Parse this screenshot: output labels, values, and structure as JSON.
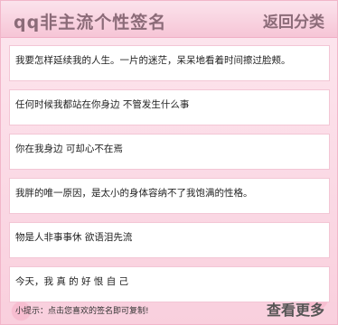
{
  "header": {
    "title": "qq非主流个性签名",
    "back_label": "返回分类"
  },
  "signatures": [
    "我要怎样延续我的人生。一片的迷茫，呆呆地看着时间擦过脸颊。",
    "任何时候我都站在你身边 不管发生什么事",
    "你在我身边 可却心不在焉",
    "我胖的唯一原因，是太小的身体容纳不了我饱满的性格。",
    "物是人非事事休 欲语泪先流",
    "今天，我 真 的 好 恨 自 己"
  ],
  "footer": {
    "hint": "小提示：点击您喜欢的签名即可复制!",
    "more_label": "查看更多"
  }
}
